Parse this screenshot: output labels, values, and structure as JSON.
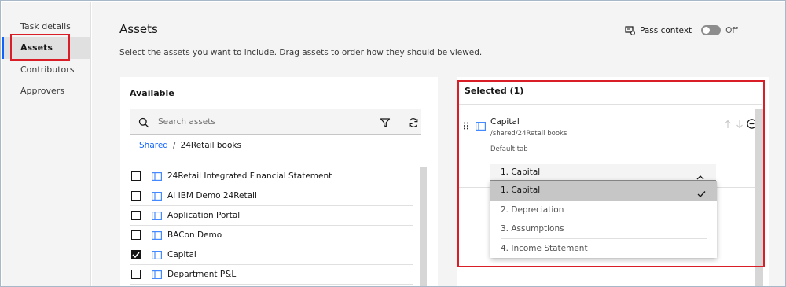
{
  "nav": {
    "items": [
      {
        "label": "Task details"
      },
      {
        "label": "Assets"
      },
      {
        "label": "Contributors"
      },
      {
        "label": "Approvers"
      }
    ]
  },
  "header": {
    "title": "Assets",
    "description": "Select the assets you want to include. Drag assets to order how they should be viewed.",
    "pass_context_label": "Pass context",
    "pass_context_state": "Off"
  },
  "available": {
    "title": "Available",
    "search_placeholder": "Search assets",
    "breadcrumb_root": "Shared",
    "breadcrumb_sep": "/",
    "breadcrumb_current": "24Retail books",
    "items": [
      {
        "label": "24Retail Integrated Financial Statement",
        "checked": false
      },
      {
        "label": "AI IBM Demo 24Retail",
        "checked": false
      },
      {
        "label": "Application Portal",
        "checked": false
      },
      {
        "label": "BACon Demo",
        "checked": false
      },
      {
        "label": "Capital",
        "checked": true
      },
      {
        "label": "Department P&L",
        "checked": false
      }
    ]
  },
  "selected": {
    "title": "Selected (1)",
    "asset": {
      "name": "Capital",
      "path": "/shared/24Retail books",
      "default_tab_label": "Default tab"
    },
    "dropdown": {
      "value": "1. Capital",
      "options": [
        {
          "label": "1. Capital",
          "selected": true
        },
        {
          "label": "2. Depreciation",
          "selected": false
        },
        {
          "label": "3. Assumptions",
          "selected": false
        },
        {
          "label": "4. Income Statement",
          "selected": false
        }
      ]
    }
  },
  "colors": {
    "accent": "#0f62fe",
    "highlight_border": "#da1e28",
    "icon_blue": "#4589ff"
  }
}
